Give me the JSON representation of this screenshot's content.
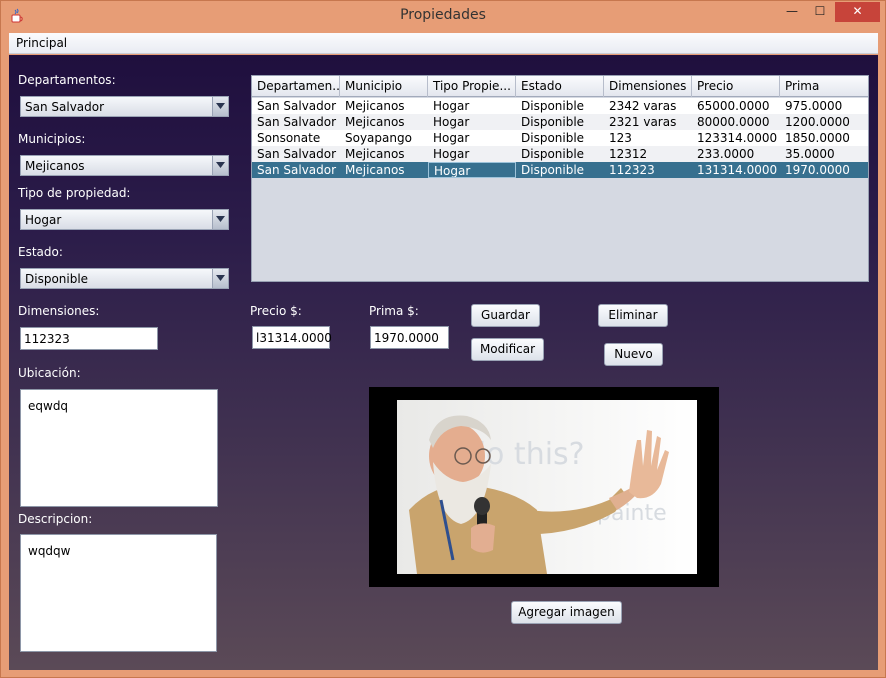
{
  "window": {
    "title": "Propiedades",
    "controls": {
      "minimize": "—",
      "maximize": "☐",
      "close": "✕"
    }
  },
  "menu": {
    "items": [
      "Principal"
    ]
  },
  "form": {
    "departamentos_label": "Departamentos:",
    "departamento_value": "San Salvador",
    "municipios_label": "Municipios:",
    "municipio_value": "Mejicanos",
    "tipo_label": "Tipo de propiedad:",
    "tipo_value": "Hogar",
    "estado_label": "Estado:",
    "estado_value": "Disponible",
    "dimensiones_label": "Dimensiones:",
    "dimensiones_value": "112323",
    "ubicacion_label": "Ubicación:",
    "ubicacion_value": "eqwdq",
    "descripcion_label": "Descripcion:",
    "descripcion_value": "wqdqw",
    "precio_label": "Precio $:",
    "precio_value": "l31314.0000",
    "prima_label": "Prima $:",
    "prima_value": "1970.0000"
  },
  "buttons": {
    "guardar": "Guardar",
    "modificar": "Modificar",
    "eliminar": "Eliminar",
    "nuevo": "Nuevo",
    "agregar_imagen": "Agregar imagen"
  },
  "table": {
    "headers": [
      "Departamen...",
      "Municipio",
      "Tipo Propie...",
      "Estado",
      "Dimensiones",
      "Precio",
      "Prima"
    ],
    "rows": [
      [
        "San Salvador",
        "Mejicanos",
        "Hogar",
        "Disponible",
        "2342 varas",
        "65000.0000",
        "975.0000"
      ],
      [
        "San Salvador",
        "Mejicanos",
        "Hogar",
        "Disponible",
        "2321 varas",
        "80000.0000",
        "1200.0000"
      ],
      [
        "Sonsonate",
        "Soyapango",
        "Hogar",
        "Disponible",
        "123",
        "123314.0000",
        "1850.0000"
      ],
      [
        "San Salvador",
        "Mejicanos",
        "Hogar",
        "Disponible",
        "12312",
        "233.0000",
        "35.0000"
      ],
      [
        "San Salvador",
        "Mejicanos",
        "Hogar",
        "Disponible",
        "112323",
        "131314.0000",
        "1970.0000"
      ]
    ],
    "selected_row": 4
  },
  "colors": {
    "selection": "#37708f",
    "close_button": "#c7443a",
    "frame": "#e79d76"
  },
  "icons": {
    "app": "java-cup-icon",
    "combo_arrow": "chevron-down-icon"
  }
}
